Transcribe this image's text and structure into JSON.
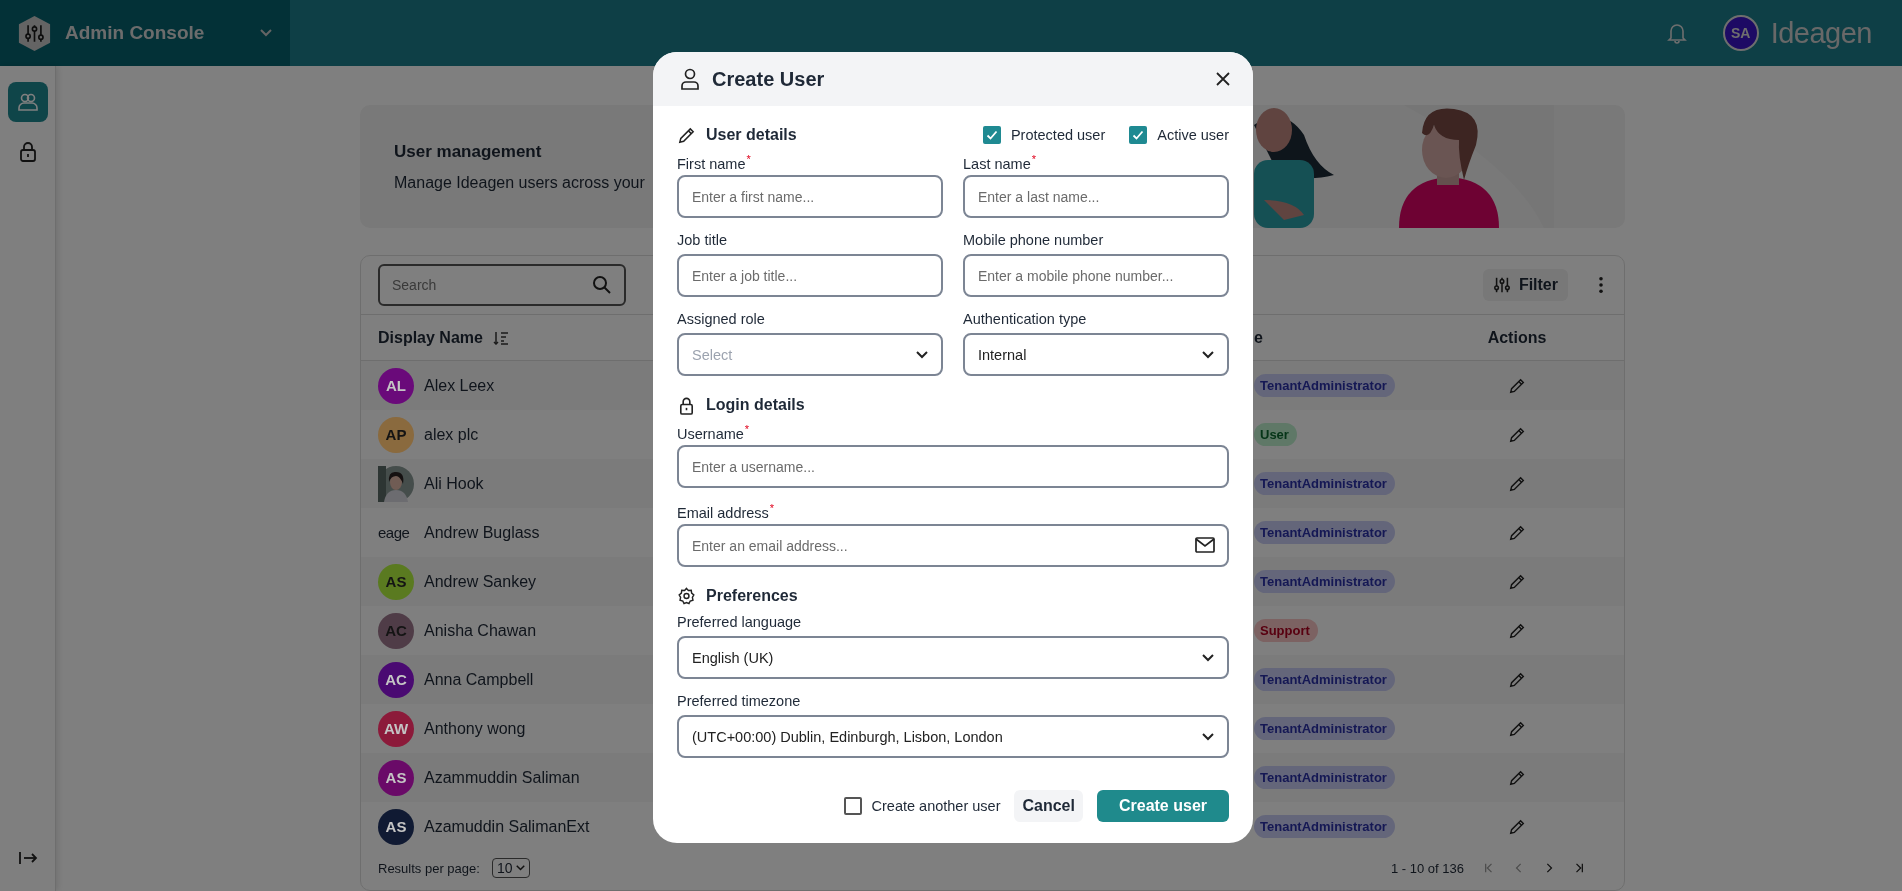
{
  "header": {
    "app_title": "Admin Console",
    "avatar_initials": "SA",
    "brand": "Ideagen"
  },
  "sidebar": {
    "items": [
      {
        "kind": "users",
        "selected": true
      },
      {
        "kind": "lock",
        "selected": false
      }
    ]
  },
  "banner": {
    "title": "User management",
    "text": "Manage Ideagen users across your"
  },
  "toolbar": {
    "search": {
      "placeholder": "Search"
    },
    "filter_label": "Filter"
  },
  "table": {
    "columns": [
      "Display Name",
      "e",
      "Actions"
    ],
    "rows": [
      {
        "name": "Alex Leex",
        "avatar": {
          "kind": "initials",
          "text": "AL",
          "color": "#6a0a7a"
        },
        "role": {
          "label": "TenantAdministrator",
          "kind": "admin"
        }
      },
      {
        "name": "alex plc",
        "avatar": {
          "kind": "initials",
          "text": "AP",
          "color": "#8a6a3e"
        },
        "role": {
          "label": "User",
          "kind": "user"
        }
      },
      {
        "name": "Ali Hook",
        "role": {
          "label": "TenantAdministrator",
          "kind": "admin"
        }
      },
      {
        "name": "Andrew Buglass",
        "avatar": {
          "kind": "logo",
          "text": "eage"
        },
        "role": {
          "label": "TenantAdministrator",
          "kind": "admin"
        }
      },
      {
        "name": "Andrew Sankey",
        "avatar": {
          "kind": "initials",
          "text": "AS",
          "color": "#5a7a20"
        },
        "role": {
          "label": "TenantAdministrator",
          "kind": "admin"
        }
      },
      {
        "name": "Anisha Chawan",
        "avatar": {
          "kind": "initials",
          "text": "AC",
          "color": "#4f3c47"
        },
        "role": {
          "label": "Support",
          "kind": "support"
        }
      },
      {
        "name": "Anna Campbell",
        "avatar": {
          "kind": "initials",
          "text": "AC",
          "color": "#4a0a72"
        },
        "role": {
          "label": "TenantAdministrator",
          "kind": "admin"
        }
      },
      {
        "name": "Anthony wong",
        "avatar": {
          "kind": "initials",
          "text": "AW",
          "color": "#8c1a3a"
        },
        "role": {
          "label": "TenantAdministrator",
          "kind": "admin"
        }
      },
      {
        "name": "Azammuddin Saliman",
        "avatar": {
          "kind": "initials",
          "text": "AS",
          "color": "#6a0a68"
        },
        "role": {
          "label": "TenantAdministrator",
          "kind": "admin"
        }
      },
      {
        "name": "Azamuddin SalimanExt",
        "avatar": {
          "kind": "initials",
          "text": "AS",
          "color": "#101a33"
        },
        "role": {
          "label": "TenantAdministrator",
          "kind": "admin"
        }
      }
    ]
  },
  "pagination": {
    "per_page_label": "Results per page:",
    "per_page": "10",
    "range": "1 - 10 of 136"
  },
  "dialog": {
    "title": "Create User",
    "sections": [
      {
        "kind": "user",
        "title": "User details",
        "toggles": [
          {
            "label": "Protected user",
            "checked": true
          },
          {
            "label": "Active user",
            "checked": true
          }
        ],
        "rows": [
          [
            {
              "label": "First name",
              "required_mark": "*",
              "kind": "text",
              "placeholder": "Enter a first name..."
            },
            {
              "label": "Last name",
              "required_mark": "*",
              "kind": "text",
              "placeholder": "Enter a last name..."
            }
          ],
          [
            {
              "label": "Job title",
              "kind": "text",
              "placeholder": "Enter a job title..."
            },
            {
              "label": "Mobile phone number",
              "kind": "text",
              "placeholder": "Enter a mobile phone number..."
            }
          ],
          [
            {
              "label": "Assigned role",
              "kind": "select",
              "placeholder": "Select"
            },
            {
              "label": "Authentication type",
              "kind": "select",
              "value": "Internal"
            }
          ]
        ]
      },
      {
        "kind": "login",
        "title": "Login details",
        "rows": [
          [
            {
              "label": "Username",
              "required_mark": "*",
              "kind": "text",
              "placeholder": "Enter a username..."
            }
          ],
          [
            {
              "label": "Email address",
              "required_mark": "*",
              "kind": "email",
              "placeholder": "Enter an email address..."
            }
          ]
        ]
      },
      {
        "kind": "preferences",
        "title": "Preferences",
        "rows": [
          [
            {
              "label": "Preferred language",
              "kind": "select",
              "value": "English (UK)"
            }
          ],
          [
            {
              "label": "Preferred timezone",
              "kind": "select",
              "value": "(UTC+00:00) Dublin, Edinburgh, Lisbon, London"
            }
          ]
        ]
      }
    ],
    "footer": {
      "another": {
        "label": "Create another user",
        "checked": false
      },
      "cancel": "Cancel",
      "submit": "Create user"
    }
  }
}
